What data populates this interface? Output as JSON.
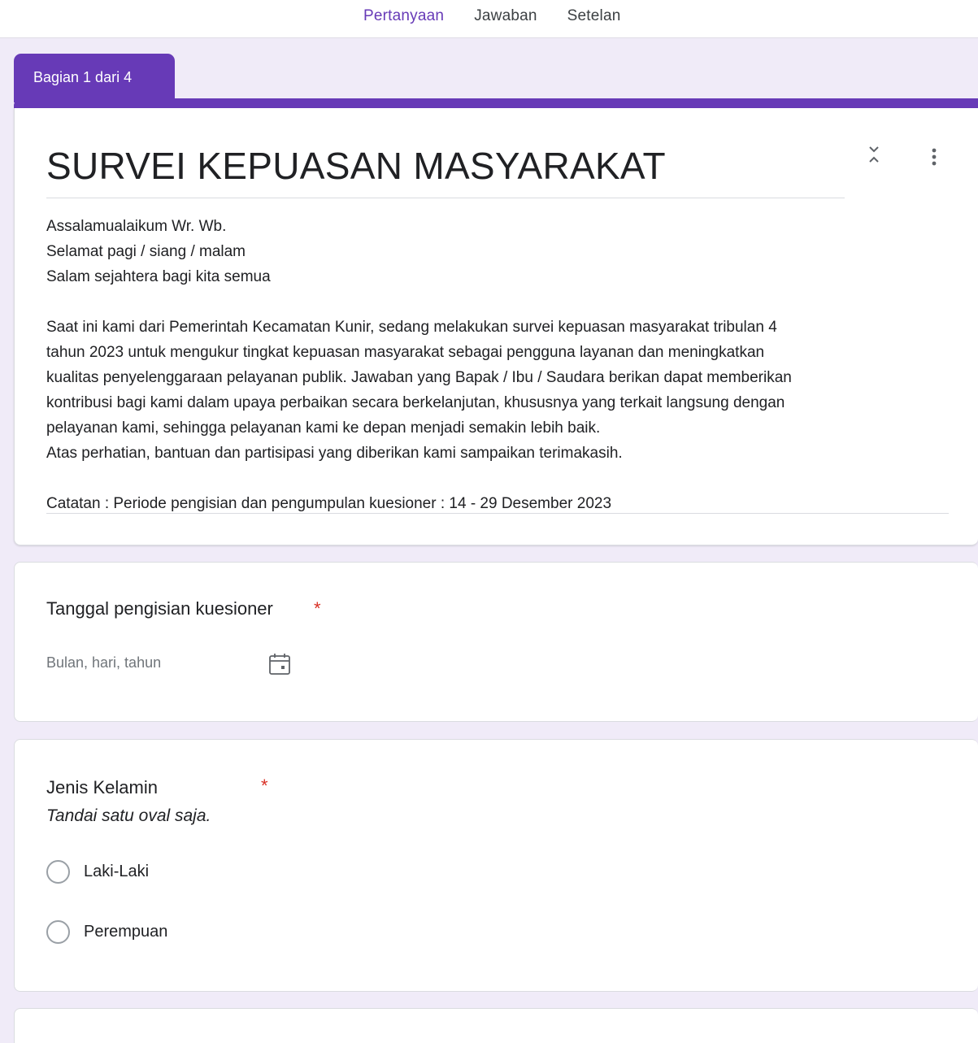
{
  "nav": {
    "tabs": [
      {
        "label": "Pertanyaan",
        "active": true
      },
      {
        "label": "Jawaban",
        "active": false
      },
      {
        "label": "Setelan",
        "active": false
      }
    ]
  },
  "section": {
    "label": "Bagian 1 dari 4"
  },
  "header": {
    "title": "SURVEI KEPUASAN MASYARAKAT",
    "greeting": [
      "Assalamualaikum Wr. Wb.",
      "Selamat pagi / siang / malam",
      "Salam sejahtera bagi kita semua"
    ],
    "body": [
      "Saat ini kami dari Pemerintah Kecamatan Kunir, sedang melakukan survei kepuasan masyarakat tribulan 4",
      "tahun 2023 untuk mengukur tingkat kepuasan masyarakat sebagai pengguna layanan dan meningkatkan",
      "kualitas penyelenggaraan pelayanan publik. Jawaban yang Bapak / Ibu / Saudara berikan dapat memberikan",
      "kontribusi bagi kami dalam upaya perbaikan secara berkelanjutan, khususnya yang terkait langsung dengan",
      "pelayanan kami, sehingga pelayanan kami ke depan menjadi semakin lebih baik.",
      "Atas perhatian, bantuan dan partisipasi yang diberikan kami sampaikan terimakasih."
    ],
    "note": "Catatan : Periode pengisian dan pengumpulan kuesioner : 14 - 29 Desember 2023"
  },
  "questions": {
    "date": {
      "title": "Tanggal pengisian kuesioner",
      "required_mark": "*",
      "placeholder": "Bulan, hari, tahun"
    },
    "gender": {
      "title": "Jenis Kelamin",
      "required_mark": "*",
      "helper": "Tandai satu oval saja.",
      "options": [
        "Laki-Laki",
        "Perempuan"
      ]
    }
  },
  "colors": {
    "accent": "#673ab7",
    "background": "#f0ebf8",
    "required": "#d93025"
  },
  "icons": [
    "collapse-icon",
    "more-vert-icon",
    "calendar-icon"
  ]
}
